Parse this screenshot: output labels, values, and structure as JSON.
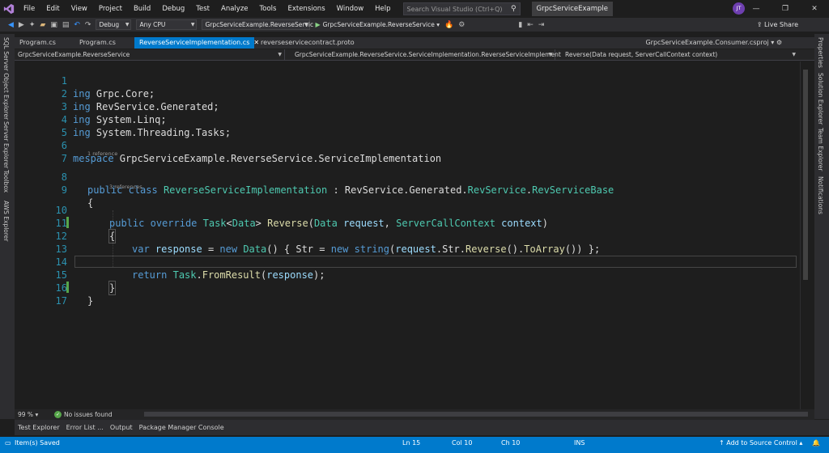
{
  "menu": {
    "items": [
      "File",
      "Edit",
      "View",
      "Project",
      "Build",
      "Debug",
      "Test",
      "Analyze",
      "Tools",
      "Extensions",
      "Window",
      "Help"
    ],
    "search_placeholder": "Search Visual Studio (Ctrl+Q)",
    "solution_name": "GrpcServiceExample",
    "avatar_initials": "JT"
  },
  "toolbar": {
    "configuration": "Debug",
    "platform": "Any CPU",
    "startup_project": "GrpcServiceExample.ReverseServic",
    "run_target": "GrpcServiceExample.ReverseService",
    "live_share": "Live Share"
  },
  "left_panels": [
    "SQL Server Object Explorer",
    "Server Explorer",
    "Toolbox",
    "AWS Explorer"
  ],
  "right_panels": [
    "Properties",
    "Solution Explorer",
    "Team Explorer",
    "Notifications"
  ],
  "tabs": [
    {
      "label": "Program.cs",
      "active": false
    },
    {
      "label": "Program.cs",
      "active": false
    },
    {
      "label": "ReverseServiceImplementation.cs",
      "active": true
    },
    {
      "label": "reverseservicecontract.proto",
      "active": false
    }
  ],
  "tab_overflow": "GrpcServiceExample.Consumer.csproj",
  "navbar": {
    "project": "GrpcServiceExample.ReverseService",
    "type": "GrpcServiceExample.ReverseService.ServiceImplementation.ReverseServiceImplement",
    "member": "Reverse(Data request, ServerCallContext context)"
  },
  "codelens": {
    "class_refs": "1 reference",
    "method_refs": "3 references"
  },
  "editor": {
    "line_numbers": [
      "1",
      "2",
      "3",
      "4",
      "5",
      "6",
      "7",
      "8",
      "9",
      "10",
      "11",
      "12",
      "13",
      "14",
      "15",
      "16",
      "17"
    ],
    "l1": [
      "ing ",
      "Grpc.Core;"
    ],
    "l2": [
      "ing ",
      "RevService.Generated;"
    ],
    "l3": [
      "ing ",
      "System.Linq;"
    ],
    "l4": [
      "ing ",
      "System.Threading.Tasks;"
    ],
    "l6": [
      "mespace ",
      "GrpcServiceExample.ReverseService.ServiceImplementation"
    ],
    "l8": [
      "public",
      " ",
      "class",
      " ",
      "ReverseServiceImplementation",
      " : RevService.Generated.",
      "RevService",
      ".",
      "RevServiceBase"
    ],
    "l9": "{",
    "l10": [
      "public",
      " ",
      "override",
      " ",
      "Task",
      "<",
      "Data",
      "> ",
      "Reverse",
      "(",
      "Data",
      " ",
      "request",
      ", ",
      "ServerCallContext",
      " ",
      "context",
      ")"
    ],
    "l11": "{",
    "l12": [
      "var",
      " ",
      "response",
      " = ",
      "new",
      " ",
      "Data",
      "() { ",
      "Str",
      " = ",
      "new",
      " ",
      "string",
      "(",
      "request",
      ".",
      "Str",
      ".",
      "Reverse",
      "().",
      "ToArray",
      "()) };"
    ],
    "l14": [
      "return",
      " ",
      "Task",
      ".",
      "FromResult",
      "(",
      "response",
      ");"
    ],
    "l15": "}",
    "l16": "}"
  },
  "editor_footer": {
    "zoom": "99 %",
    "issues": "No issues found"
  },
  "tool_tabs": [
    "Test Explorer",
    "Error List ...",
    "Output",
    "Package Manager Console"
  ],
  "status": {
    "message": "Item(s) Saved",
    "ln": "Ln 15",
    "col": "Col 10",
    "ch": "Ch 10",
    "mode": "INS",
    "source_control": "Add to Source Control"
  },
  "colors": {
    "accent": "#007acc",
    "keyword": "#569cd6",
    "type": "#4ec9b0",
    "method": "#dcdcaa",
    "parameter": "#9cdcfe",
    "line_number": "#2b91af"
  }
}
